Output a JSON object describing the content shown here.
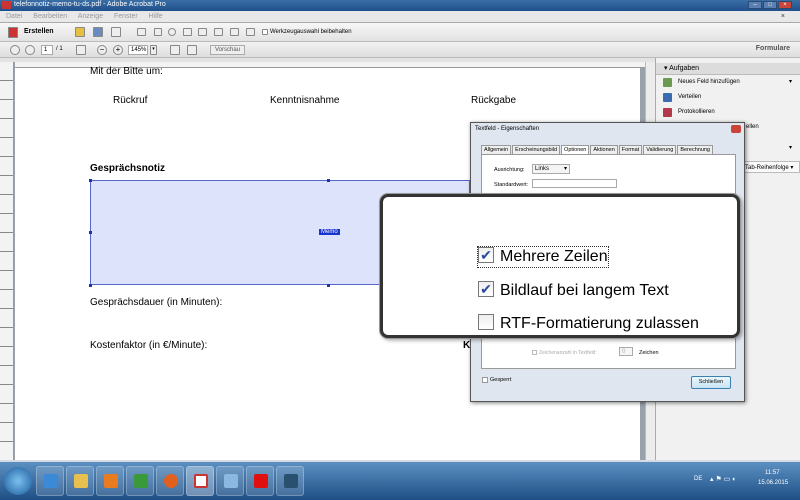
{
  "window": {
    "title": "telefonnotiz-memo-tu-ds.pdf - Adobe Acrobat Pro"
  },
  "menu": [
    "Datei",
    "Bearbeiten",
    "Anzeige",
    "Fenster",
    "Hilfe"
  ],
  "toolbar": {
    "create_label": "Erstellen",
    "keep_tool_label": "Werkzeugauswahl beibehalten",
    "page_current": "1",
    "page_total": "/ 1",
    "zoom": "145%",
    "preview_label": "Vorschau"
  },
  "formbar": {
    "title": "Formulare"
  },
  "document": {
    "line1": "Mit der Bitte um:",
    "opt1": "Rückruf",
    "opt2": "Kenntnisnahme",
    "opt3": "Rückgabe",
    "section": "Gesprächsnotiz",
    "field_name": "Memo",
    "duration": "Gesprächsdauer (in Minuten):",
    "cost": "Kostenfaktor (in €/Minute):",
    "cut_label": "K"
  },
  "panel": {
    "header": "Aufgaben",
    "items": [
      "Neues Feld hinzufügen",
      "Verteilen",
      "Protokollieren",
      "ellen"
    ],
    "tab_order": "Tab-Reihenfolge"
  },
  "dialog": {
    "title": "Textfeld - Eigenschaften",
    "tabs": [
      "Allgemein",
      "Erscheinungsbild",
      "Optionen",
      "Aktionen",
      "Format",
      "Validierung",
      "Berechnung"
    ],
    "active_tab": "Optionen",
    "align_label": "Ausrichtung:",
    "align_value": "Links",
    "default_label": "Standardwert:",
    "default_value": "",
    "char_limit_label": "Zeichenanzahl in Textfeld:",
    "char_limit_value": "0",
    "char_unit": "Zeichen",
    "locked_label": "Gesperrt",
    "close_label": "Schließen"
  },
  "callout": {
    "options": [
      {
        "label": "Mehrere Zeilen",
        "checked": true
      },
      {
        "label": "Bildlauf bei langem Text",
        "checked": true
      },
      {
        "label": "RTF-Formatierung zulassen",
        "checked": false
      }
    ]
  },
  "taskbar": {
    "lang": "DE",
    "time": "11:57",
    "date": "15.06.2015"
  }
}
